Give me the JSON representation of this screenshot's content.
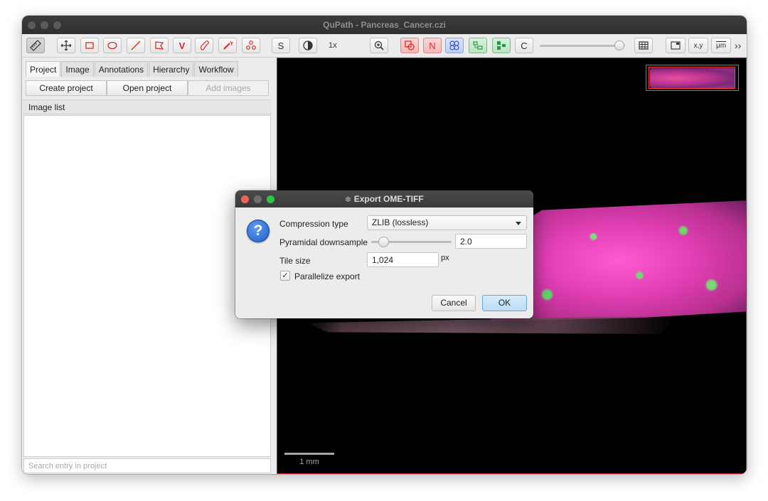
{
  "window": {
    "title": "QuPath - Pancreas_Cancer.czi"
  },
  "toolbar": {
    "zoom_label": "1x",
    "s_label": "S",
    "n_label": "N",
    "c_label": "C",
    "v_label": "V",
    "xy_label": "x,y",
    "um_label": "μm",
    "more_label": "››",
    "icons": [
      "ruler-icon",
      "move-icon",
      "rectangle-icon",
      "ellipse-icon",
      "line-icon",
      "polygon-icon",
      "v-tool-icon",
      "brush-icon",
      "wand-icon",
      "points-icon",
      "brightness-contrast-icon",
      "zoom-to-fit-icon",
      "show-annotations-icon",
      "show-names-icon",
      "show-detections-icon",
      "fill-detections-icon",
      "pixel-classification-icon",
      "grid-icon",
      "overview-icon",
      "location-icon",
      "scalebar-icon"
    ]
  },
  "left_panel": {
    "tabs": [
      "Project",
      "Image",
      "Annotations",
      "Hierarchy",
      "Workflow"
    ],
    "active_tab": "Project",
    "buttons": {
      "create": "Create project",
      "open": "Open project",
      "add": "Add images"
    },
    "list_header": "Image list",
    "search_placeholder": "Search entry in project"
  },
  "viewer": {
    "scale_label": "1 mm"
  },
  "dialog": {
    "title": "Export OME-TIFF",
    "compression_label": "Compression type",
    "compression_value": "ZLIB (lossless)",
    "downsample_label": "Pyramidal downsample",
    "downsample_value": "2.0",
    "tile_label": "Tile size",
    "tile_value": "1,024",
    "tile_unit": "px",
    "parallelize_label": "Parallelize export",
    "parallelize_checked": true,
    "check_mark": "✓",
    "cancel_label": "Cancel",
    "ok_label": "OK"
  },
  "colors": {
    "viewer_border": "#c02a2a",
    "ok_button": "#b9dcf5",
    "question_icon": "#2a6ad8"
  }
}
